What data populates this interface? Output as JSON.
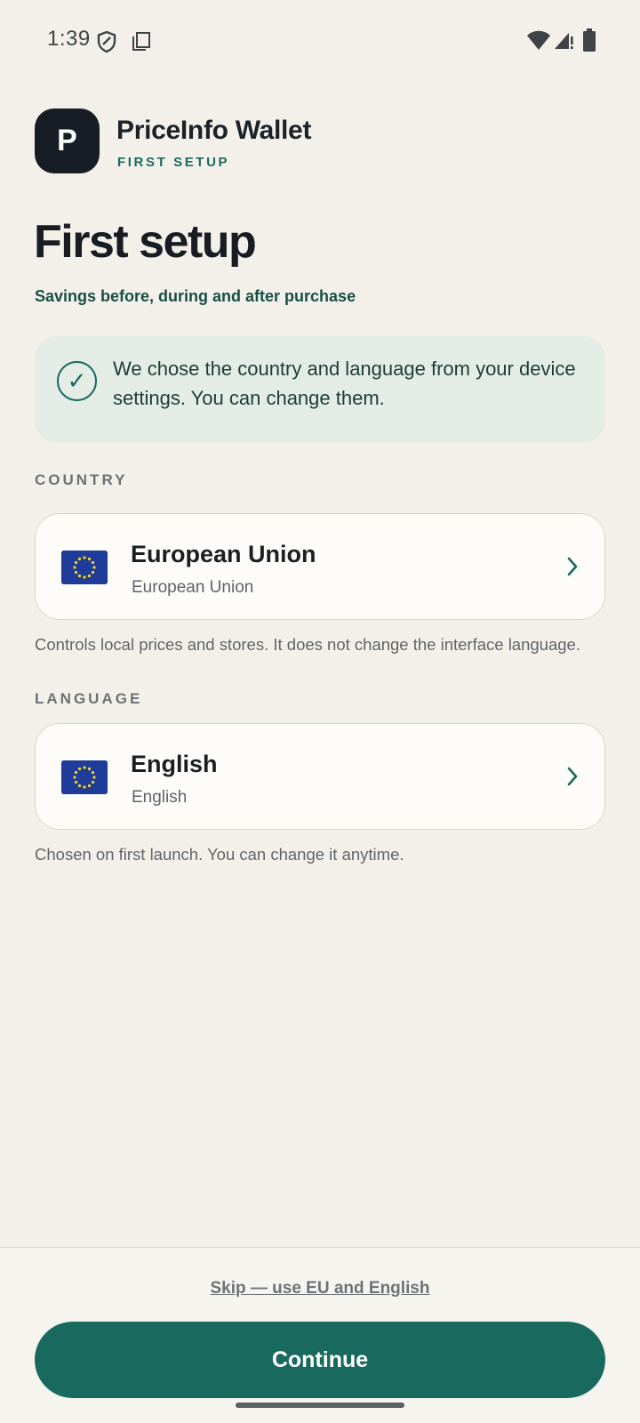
{
  "status_bar": {
    "time": "1:39",
    "icons": [
      "shield-icon",
      "copy-icon",
      "wifi-icon",
      "signal-icon",
      "battery-icon"
    ]
  },
  "app": {
    "logo_letter": "P",
    "name": "PriceInfo Wallet",
    "subtitle": "FIRST SETUP"
  },
  "page": {
    "title": "First setup",
    "tagline": "Savings before, during and after purchase"
  },
  "info_banner": {
    "icon": "check-circle-icon",
    "check_glyph": "✓",
    "text": "We chose the country and language from your device settings. You can change them."
  },
  "country": {
    "section_label": "COUNTRY",
    "title": "European Union",
    "subtitle": "European Union",
    "flag": "eu-flag-icon",
    "helper": "Controls local prices and stores. It does not change the interface language."
  },
  "language": {
    "section_label": "LANGUAGE",
    "title": "English",
    "subtitle": "English",
    "flag": "eu-flag-icon",
    "helper": "Chosen on first launch. You can change it anytime."
  },
  "footer": {
    "skip_label": "Skip — use EU and English",
    "continue_label": "Continue"
  },
  "colors": {
    "background": "#f3f0e9",
    "accent": "#196a5e",
    "banner": "#e3ede6",
    "logo": "#161d25",
    "flag_blue": "#1f3c9a",
    "flag_star": "#f7d51c"
  }
}
